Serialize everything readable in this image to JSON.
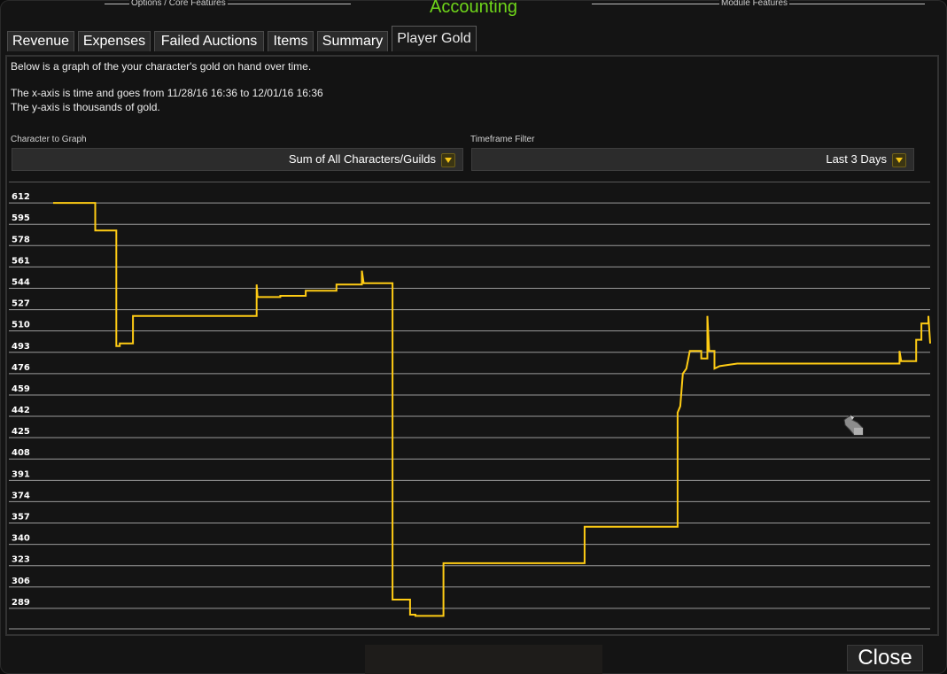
{
  "window": {
    "title": "Accounting",
    "header_left": "Options / Core Features",
    "header_right": "Module Features"
  },
  "tabs": [
    {
      "label": "Revenue"
    },
    {
      "label": "Expenses"
    },
    {
      "label": "Failed Auctions"
    },
    {
      "label": "Items"
    },
    {
      "label": "Summary"
    },
    {
      "label": "Player Gold",
      "active": true
    }
  ],
  "description": {
    "line1": "Below is a graph of the your character's gold on hand over time.",
    "line2": "The x-axis is time and goes from 11/28/16 16:36 to 12/01/16 16:36",
    "line3": "The y-axis is thousands of gold."
  },
  "filters": {
    "character_label": "Character to Graph",
    "character_value": "Sum of All Characters/Guilds",
    "timeframe_label": "Timeframe Filter",
    "timeframe_value": "Last 3 Days"
  },
  "chart_data": {
    "type": "line",
    "xlabel": "",
    "ylabel": "",
    "yticks": [
      612,
      595,
      578,
      561,
      544,
      527,
      510,
      493,
      476,
      459,
      442,
      425,
      408,
      391,
      374,
      357,
      340,
      323,
      306,
      289
    ],
    "ylim": [
      272,
      629
    ],
    "grid": true,
    "color": "#ffcc14",
    "series": [
      {
        "points": [
          [
            0.0,
            612
          ],
          [
            4.8,
            612
          ],
          [
            4.8,
            590
          ],
          [
            7.2,
            590
          ],
          [
            7.2,
            498
          ],
          [
            7.6,
            498
          ],
          [
            7.6,
            500
          ],
          [
            9.1,
            500
          ],
          [
            9.1,
            522
          ],
          [
            23.2,
            522
          ],
          [
            23.2,
            547
          ],
          [
            23.3,
            537
          ],
          [
            25.9,
            537
          ],
          [
            25.9,
            538
          ],
          [
            28.8,
            538
          ],
          [
            28.8,
            542
          ],
          [
            32.3,
            542
          ],
          [
            32.3,
            547
          ],
          [
            35.2,
            547
          ],
          [
            35.2,
            558
          ],
          [
            35.4,
            548
          ],
          [
            38.7,
            548
          ],
          [
            38.7,
            296
          ],
          [
            40.7,
            296
          ],
          [
            40.7,
            284
          ],
          [
            41.3,
            284
          ],
          [
            41.3,
            283
          ],
          [
            44.5,
            283
          ],
          [
            44.5,
            325
          ],
          [
            60.6,
            325
          ],
          [
            60.6,
            354
          ],
          [
            71.2,
            354
          ],
          [
            71.2,
            445
          ],
          [
            71.5,
            450
          ],
          [
            71.8,
            476
          ],
          [
            72.2,
            480
          ],
          [
            72.6,
            494
          ],
          [
            73.9,
            494
          ],
          [
            73.9,
            488
          ],
          [
            74.6,
            488
          ],
          [
            74.6,
            522
          ],
          [
            74.8,
            494
          ],
          [
            75.4,
            494
          ],
          [
            75.4,
            480
          ],
          [
            76.0,
            482
          ],
          [
            78.0,
            484
          ],
          [
            96.5,
            484
          ],
          [
            96.5,
            494
          ],
          [
            96.7,
            486
          ],
          [
            98.4,
            486
          ],
          [
            98.4,
            503
          ],
          [
            99.0,
            503
          ],
          [
            99.0,
            516
          ],
          [
            99.8,
            516
          ],
          [
            99.8,
            522
          ],
          [
            100.0,
            500
          ]
        ]
      }
    ]
  },
  "buttons": {
    "close_label": "Close"
  },
  "icons": {
    "cursor": "gauntlet-cursor-icon",
    "dropdown": "dropdown-arrow-icon"
  }
}
